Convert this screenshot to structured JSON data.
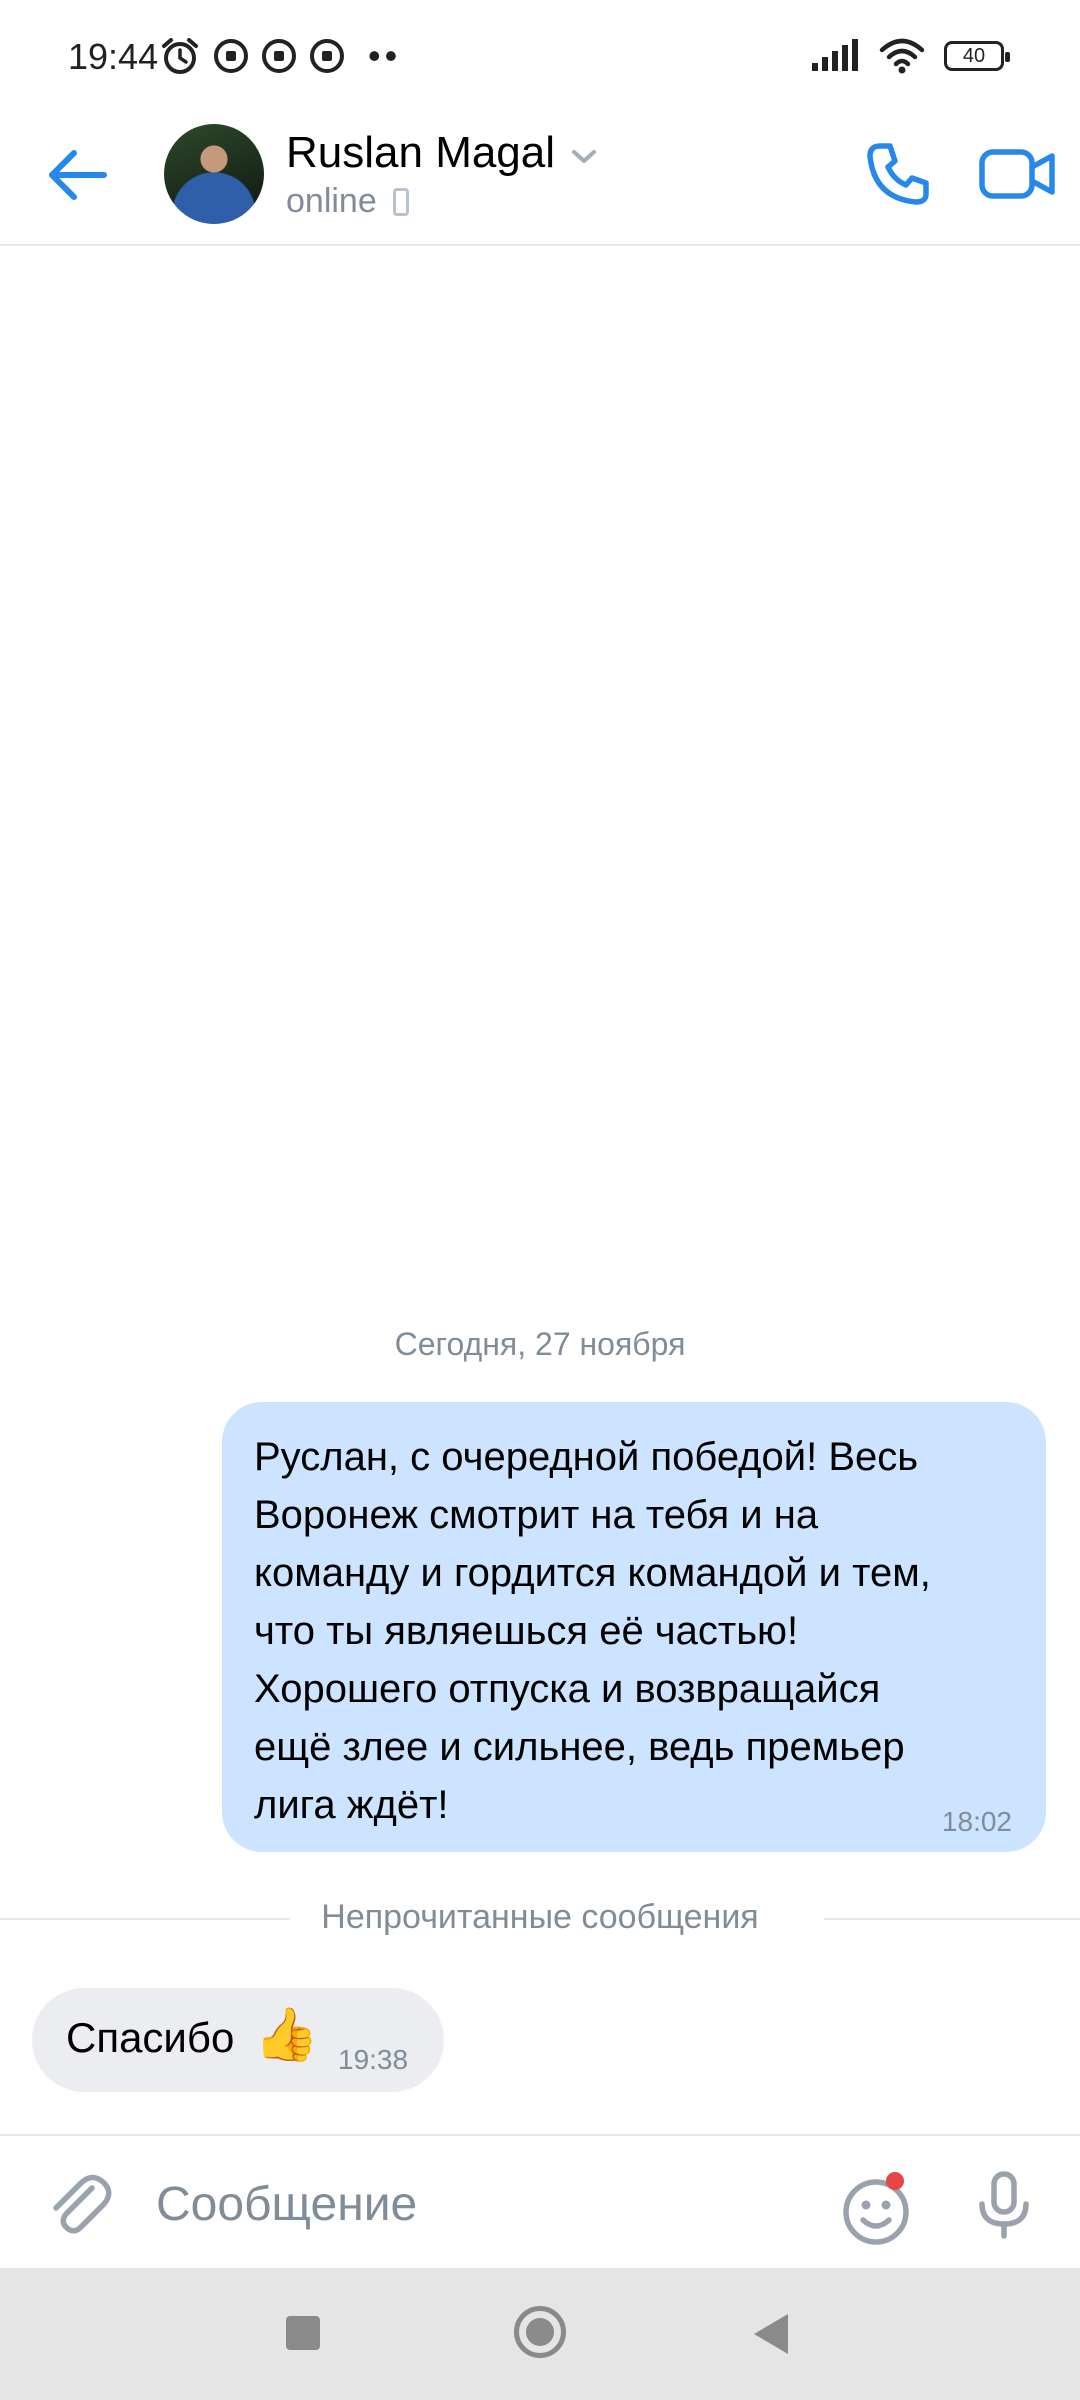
{
  "status_bar": {
    "time": "19:44",
    "battery": "40",
    "dots": "••"
  },
  "header": {
    "contact_name": "Ruslan Magal",
    "status": "online"
  },
  "chat": {
    "date_separator": "Сегодня, 27 ноября",
    "outgoing_message": {
      "text": "Руслан, с очередной победой! Весь\nВоронеж смотрит на тебя и на\nкоманду и гордится командой и тем,\nчто ты являешься её частью!\nХорошего отпуска и возвращайся\nещё злее и сильнее, ведь премьер\nлига ждёт!",
      "time": "18:02"
    },
    "unread_label": "Непрочитанные сообщения",
    "incoming_message": {
      "text": "Спасибо",
      "emoji": "👍",
      "time": "19:38"
    }
  },
  "composer": {
    "placeholder": "Сообщение"
  },
  "colors": {
    "accent": "#2688eb",
    "outgoing_bubble": "#cce4ff",
    "incoming_bubble": "#ebedf0",
    "secondary_text": "#818c99"
  }
}
